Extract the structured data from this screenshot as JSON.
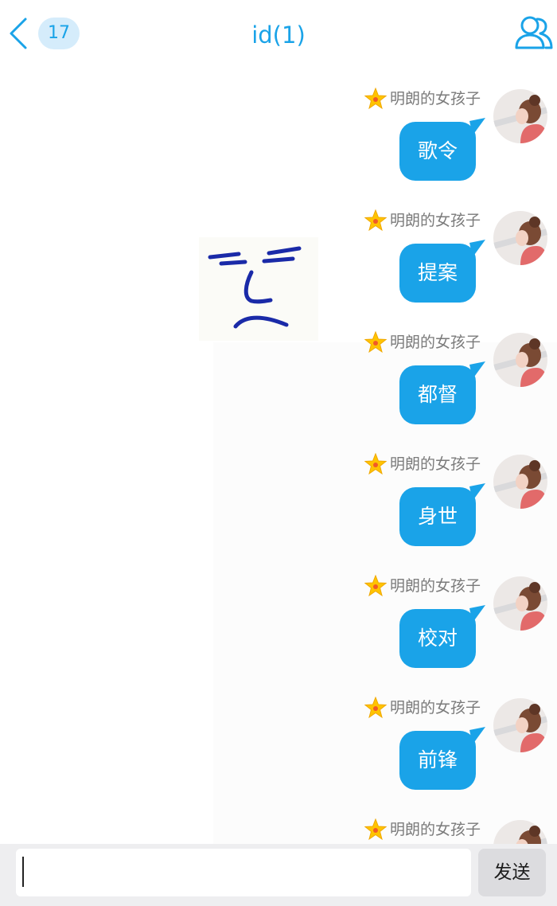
{
  "header": {
    "back_icon": "chevron-left-icon",
    "unread_count": "17",
    "title": "id(1)",
    "contacts_icon": "group-contacts-icon",
    "accent_color": "#1aa3e8"
  },
  "chat": {
    "messages": [
      {
        "sender": "明朗的女孩子",
        "text": "歌令"
      },
      {
        "sender": "明朗的女孩子",
        "text": "提案"
      },
      {
        "sender": "明朗的女孩子",
        "text": "都督"
      },
      {
        "sender": "明朗的女孩子",
        "text": "身世"
      },
      {
        "sender": "明朗的女孩子",
        "text": "校对"
      },
      {
        "sender": "明朗的女孩子",
        "text": "前锋"
      },
      {
        "sender": "明朗的女孩子",
        "text": ""
      }
    ],
    "bubble_color": "#1aa3e8",
    "star_icon": "star-icon",
    "background_image": "doodle-face-sticker"
  },
  "composer": {
    "input_value": "",
    "send_label": "发送"
  }
}
